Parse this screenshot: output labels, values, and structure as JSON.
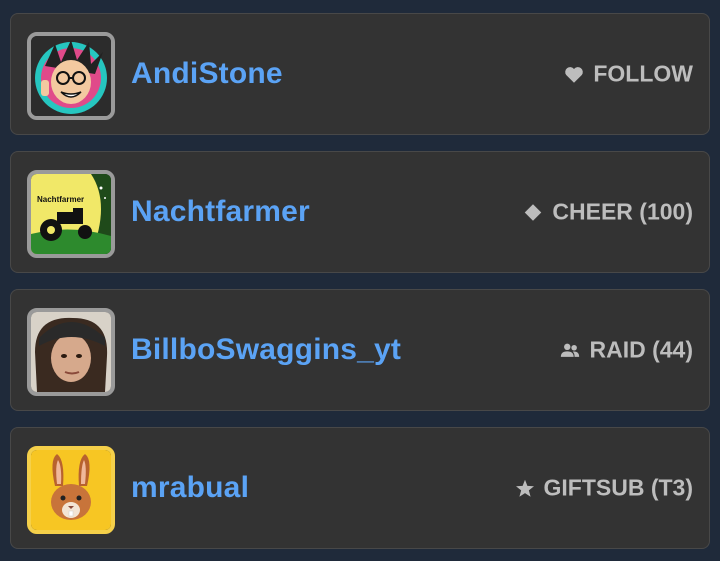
{
  "events": [
    {
      "user": "AndiStone",
      "event_label": "FOLLOW",
      "icon": "heart-icon"
    },
    {
      "user": "Nachtfarmer",
      "event_label": "CHEER (100)",
      "icon": "diamond-icon",
      "avatar_text": "Nachtfarmer"
    },
    {
      "user": "BillboSwaggins_yt",
      "event_label": "RAID (44)",
      "icon": "users-icon"
    },
    {
      "user": "mrabual",
      "event_label": "GIFTSUB (T3)",
      "icon": "star-icon"
    }
  ],
  "colors": {
    "background": "#1f2a3a",
    "card": "#333333",
    "username": "#5ba3f5",
    "event_text": "#bdbdbd"
  }
}
